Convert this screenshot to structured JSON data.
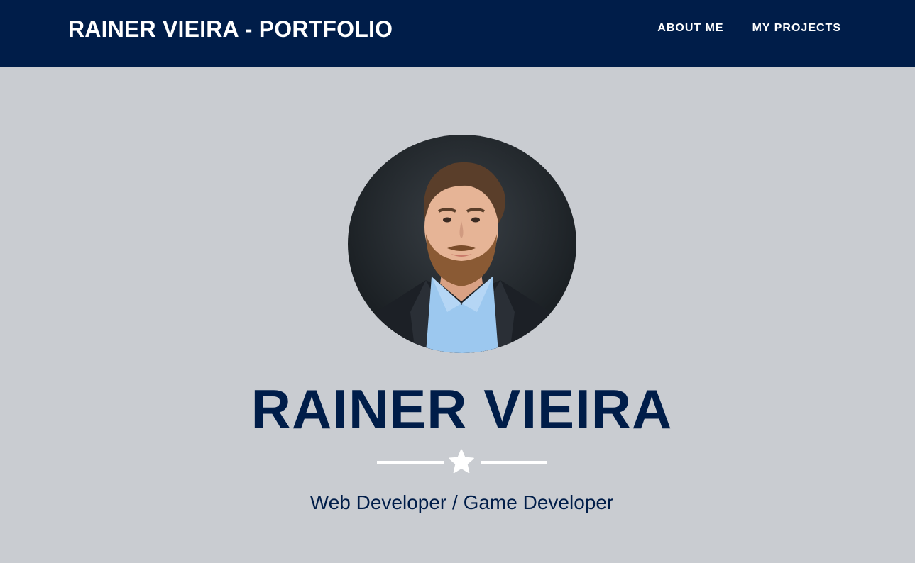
{
  "navbar": {
    "brand": "RAINER VIEIRA - PORTFOLIO",
    "links": [
      {
        "label": "ABOUT ME"
      },
      {
        "label": "MY PROJECTS"
      }
    ]
  },
  "hero": {
    "title": "RAINER VIEIRA",
    "subtitle": "Web Developer / Game Developer",
    "divider_icon": "star-icon"
  },
  "colors": {
    "navbar_bg": "#001d49",
    "page_bg": "#c9ccd1",
    "primary_text": "#001d49",
    "divider": "#ffffff"
  }
}
